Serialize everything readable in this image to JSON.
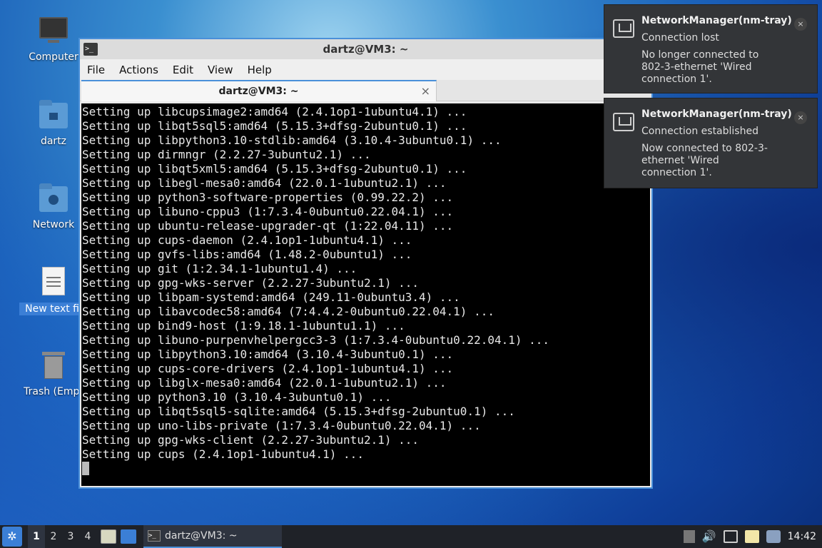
{
  "desktop": {
    "icons": [
      {
        "label": "Computer"
      },
      {
        "label": "dartz"
      },
      {
        "label": "Network"
      },
      {
        "label": "New text fil"
      },
      {
        "label": "Trash (Empt"
      }
    ]
  },
  "terminal": {
    "title": "dartz@VM3: ~",
    "menu": [
      "File",
      "Actions",
      "Edit",
      "View",
      "Help"
    ],
    "tab_label": "dartz@VM3: ~",
    "tab_close": "×",
    "lines": [
      "Setting up libcupsimage2:amd64 (2.4.1op1-1ubuntu4.1) ...",
      "Setting up libqt5sql5:amd64 (5.15.3+dfsg-2ubuntu0.1) ...",
      "Setting up libpython3.10-stdlib:amd64 (3.10.4-3ubuntu0.1) ...",
      "Setting up dirmngr (2.2.27-3ubuntu2.1) ...",
      "Setting up libqt5xml5:amd64 (5.15.3+dfsg-2ubuntu0.1) ...",
      "Setting up libegl-mesa0:amd64 (22.0.1-1ubuntu2.1) ...",
      "Setting up python3-software-properties (0.99.22.2) ...",
      "Setting up libuno-cppu3 (1:7.3.4-0ubuntu0.22.04.1) ...",
      "Setting up ubuntu-release-upgrader-qt (1:22.04.11) ...",
      "Setting up cups-daemon (2.4.1op1-1ubuntu4.1) ...",
      "Setting up gvfs-libs:amd64 (1.48.2-0ubuntu1) ...",
      "Setting up git (1:2.34.1-1ubuntu1.4) ...",
      "Setting up gpg-wks-server (2.2.27-3ubuntu2.1) ...",
      "Setting up libpam-systemd:amd64 (249.11-0ubuntu3.4) ...",
      "Setting up libavcodec58:amd64 (7:4.4.2-0ubuntu0.22.04.1) ...",
      "Setting up bind9-host (1:9.18.1-1ubuntu1.1) ...",
      "Setting up libuno-purpenvhelpergcc3-3 (1:7.3.4-0ubuntu0.22.04.1) ...",
      "Setting up libpython3.10:amd64 (3.10.4-3ubuntu0.1) ...",
      "Setting up cups-core-drivers (2.4.1op1-1ubuntu4.1) ...",
      "Setting up libglx-mesa0:amd64 (22.0.1-1ubuntu2.1) ...",
      "Setting up python3.10 (3.10.4-3ubuntu0.1) ...",
      "Setting up libqt5sql5-sqlite:amd64 (5.15.3+dfsg-2ubuntu0.1) ...",
      "Setting up uno-libs-private (1:7.3.4-0ubuntu0.22.04.1) ...",
      "Setting up gpg-wks-client (2.2.27-3ubuntu2.1) ...",
      "Setting up cups (2.4.1op1-1ubuntu4.1) ..."
    ]
  },
  "notifications": [
    {
      "app": "NetworkManager(nm-tray)",
      "summary": "Connection lost",
      "body": "No longer connected to 802-3-ethernet 'Wired connection 1'.",
      "close": "×"
    },
    {
      "app": "NetworkManager(nm-tray)",
      "summary": "Connection established",
      "body": "Now connected to 802-3-ethernet 'Wired connection 1'.",
      "close": "×"
    }
  ],
  "taskbar": {
    "workspaces": [
      "1",
      "2",
      "3",
      "4"
    ],
    "task_label": "dartz@VM3: ~",
    "clock": "14:42"
  },
  "colors": {
    "accent": "#4a90d9",
    "terminal_bg": "#000000",
    "notification_bg": "#333538"
  }
}
